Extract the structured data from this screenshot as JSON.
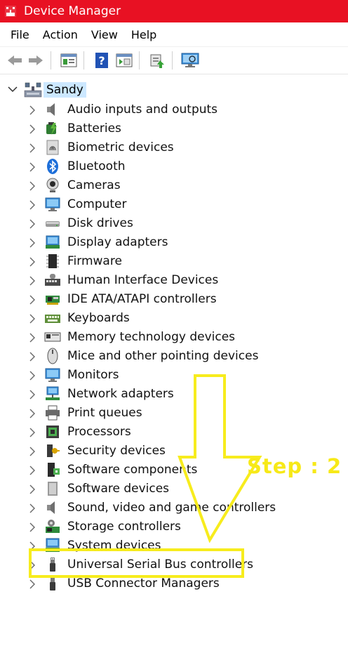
{
  "window": {
    "title": "Device Manager"
  },
  "menu": [
    "File",
    "Action",
    "View",
    "Help"
  ],
  "toolbar": {
    "buttons": [
      "back-icon",
      "forward-icon",
      "properties-icon",
      "help-icon",
      "show-hidden-icon",
      "update-driver-icon",
      "scan-hardware-icon"
    ]
  },
  "tree": {
    "root": "Sandy",
    "items": [
      {
        "label": "Audio inputs and outputs",
        "icon": "speaker-icon"
      },
      {
        "label": "Batteries",
        "icon": "battery-icon"
      },
      {
        "label": "Biometric devices",
        "icon": "fingerprint-icon"
      },
      {
        "label": "Bluetooth",
        "icon": "bluetooth-icon"
      },
      {
        "label": "Cameras",
        "icon": "camera-icon"
      },
      {
        "label": "Computer",
        "icon": "computer-icon"
      },
      {
        "label": "Disk drives",
        "icon": "disk-drive-icon"
      },
      {
        "label": "Display adapters",
        "icon": "display-adapter-icon"
      },
      {
        "label": "Firmware",
        "icon": "firmware-icon"
      },
      {
        "label": "Human Interface Devices",
        "icon": "hid-icon"
      },
      {
        "label": "IDE ATA/ATAPI controllers",
        "icon": "ide-controller-icon"
      },
      {
        "label": "Keyboards",
        "icon": "keyboard-icon"
      },
      {
        "label": "Memory technology devices",
        "icon": "memory-icon"
      },
      {
        "label": "Mice and other pointing devices",
        "icon": "mouse-icon"
      },
      {
        "label": "Monitors",
        "icon": "monitor-icon"
      },
      {
        "label": "Network adapters",
        "icon": "network-adapter-icon"
      },
      {
        "label": "Print queues",
        "icon": "printer-icon"
      },
      {
        "label": "Processors",
        "icon": "processor-icon"
      },
      {
        "label": "Security devices",
        "icon": "security-device-icon"
      },
      {
        "label": "Software components",
        "icon": "software-component-icon"
      },
      {
        "label": "Software devices",
        "icon": "software-device-icon"
      },
      {
        "label": "Sound, video and game controllers",
        "icon": "sound-controller-icon"
      },
      {
        "label": "Storage controllers",
        "icon": "storage-controller-icon"
      },
      {
        "label": "System devices",
        "icon": "system-device-icon"
      },
      {
        "label": "Universal Serial Bus controllers",
        "icon": "usb-icon"
      },
      {
        "label": "USB Connector Managers",
        "icon": "usb-connector-icon"
      }
    ]
  },
  "annotation": {
    "step_text": "Step : 2",
    "color": "#f7ec1d"
  },
  "colors": {
    "titlebar": "#e81123",
    "selection": "#cce8ff"
  }
}
